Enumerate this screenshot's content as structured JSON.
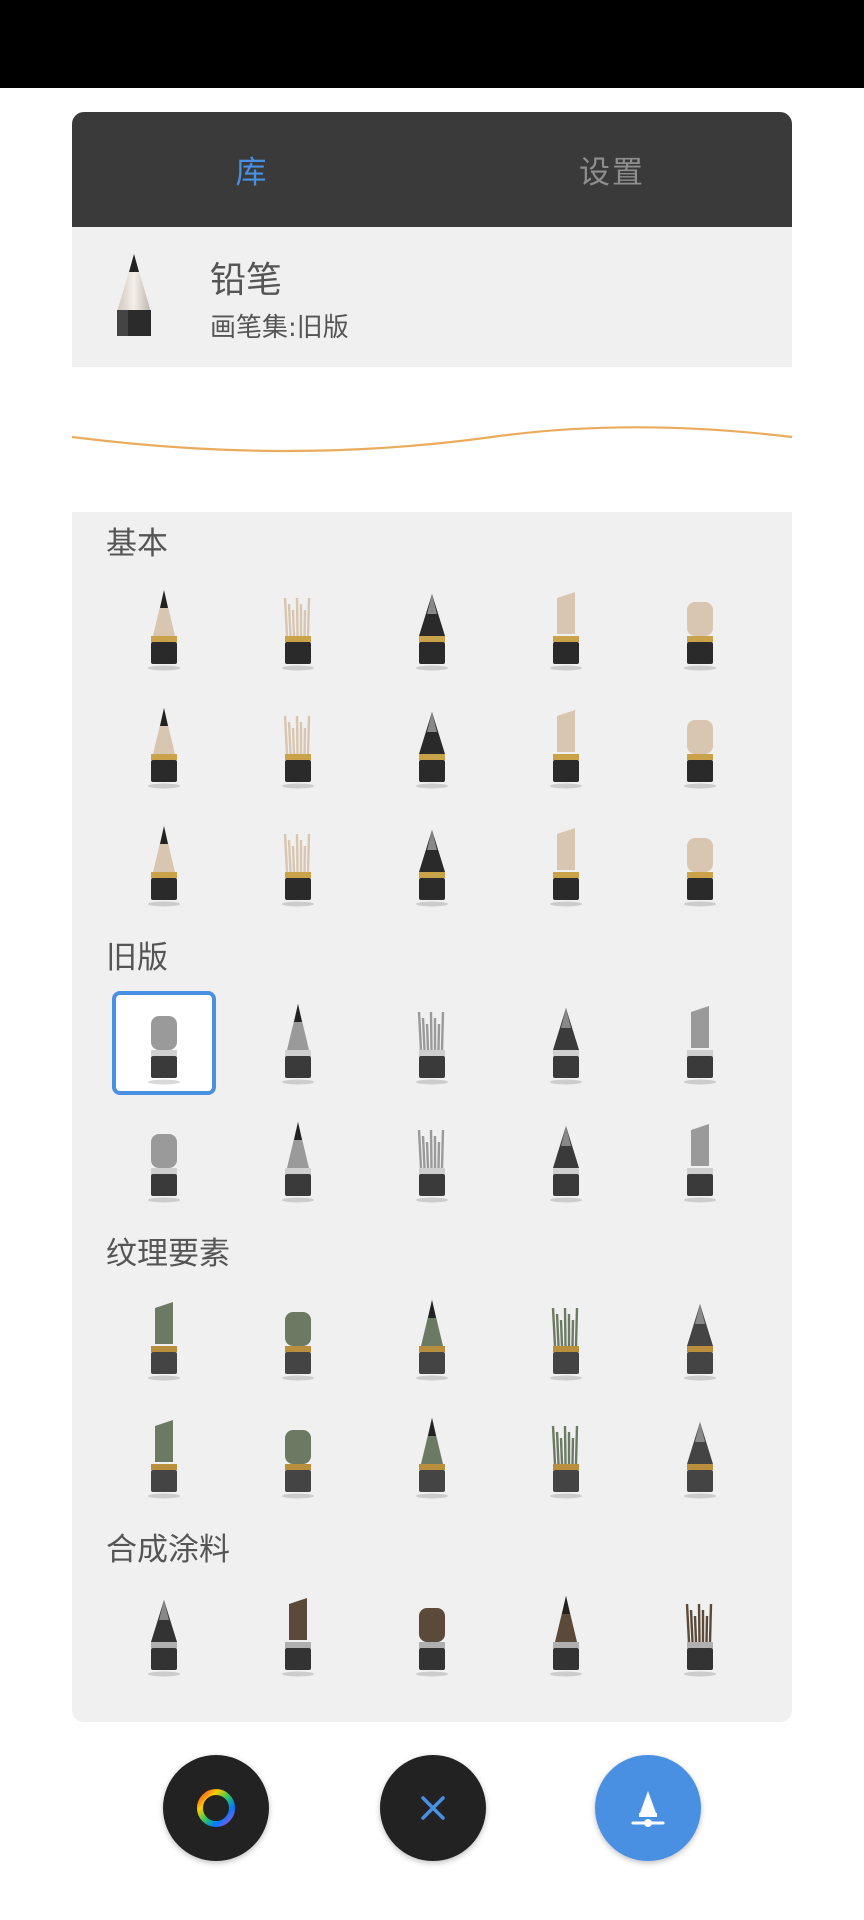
{
  "tabs": [
    {
      "label": "库",
      "active": true
    },
    {
      "label": "设置",
      "active": false
    }
  ],
  "current_brush": {
    "name": "铅笔",
    "set": "画笔集:旧版",
    "icon": "pencil-icon"
  },
  "stroke_color": "#e8a24a",
  "sections": [
    {
      "title": "基本",
      "brushes": [
        "pencil",
        "chisel-marker",
        "airbrush",
        "technical-pen",
        "fountain-pen",
        "round-brush",
        "ink-brush",
        "cone-brush",
        "eraser-block",
        "eraser-slant",
        "charcoal-block",
        "crumble-block",
        "fan-brush",
        "wide-bristle",
        "flat-bristle"
      ]
    },
    {
      "title": "旧版",
      "brushes": [
        "pencil",
        "airbrush",
        "marker",
        "chisel",
        "ballpoint",
        "round-brush",
        "small-brush",
        "nib-pen",
        "eraser-square",
        "eraser-round"
      ],
      "selected_index": 0
    },
    {
      "title": "纹理要素",
      "brushes": [
        "cone-dark",
        "pencil-tex",
        "block-tex",
        "bristle-tex",
        "crumble-tex",
        "big-cone-tex",
        "brush-tex",
        "dome-tex",
        "airbrush-tex",
        "chalk-tex"
      ]
    },
    {
      "title": "合成涂料",
      "brushes": [
        "brush-a",
        "brush-b",
        "brush-c",
        "brush-d",
        "brush-e"
      ]
    }
  ],
  "fabs": [
    {
      "name": "color-wheel-icon"
    },
    {
      "name": "close-icon"
    },
    {
      "name": "brush-settings-icon"
    }
  ],
  "accent": "#4a90e2"
}
